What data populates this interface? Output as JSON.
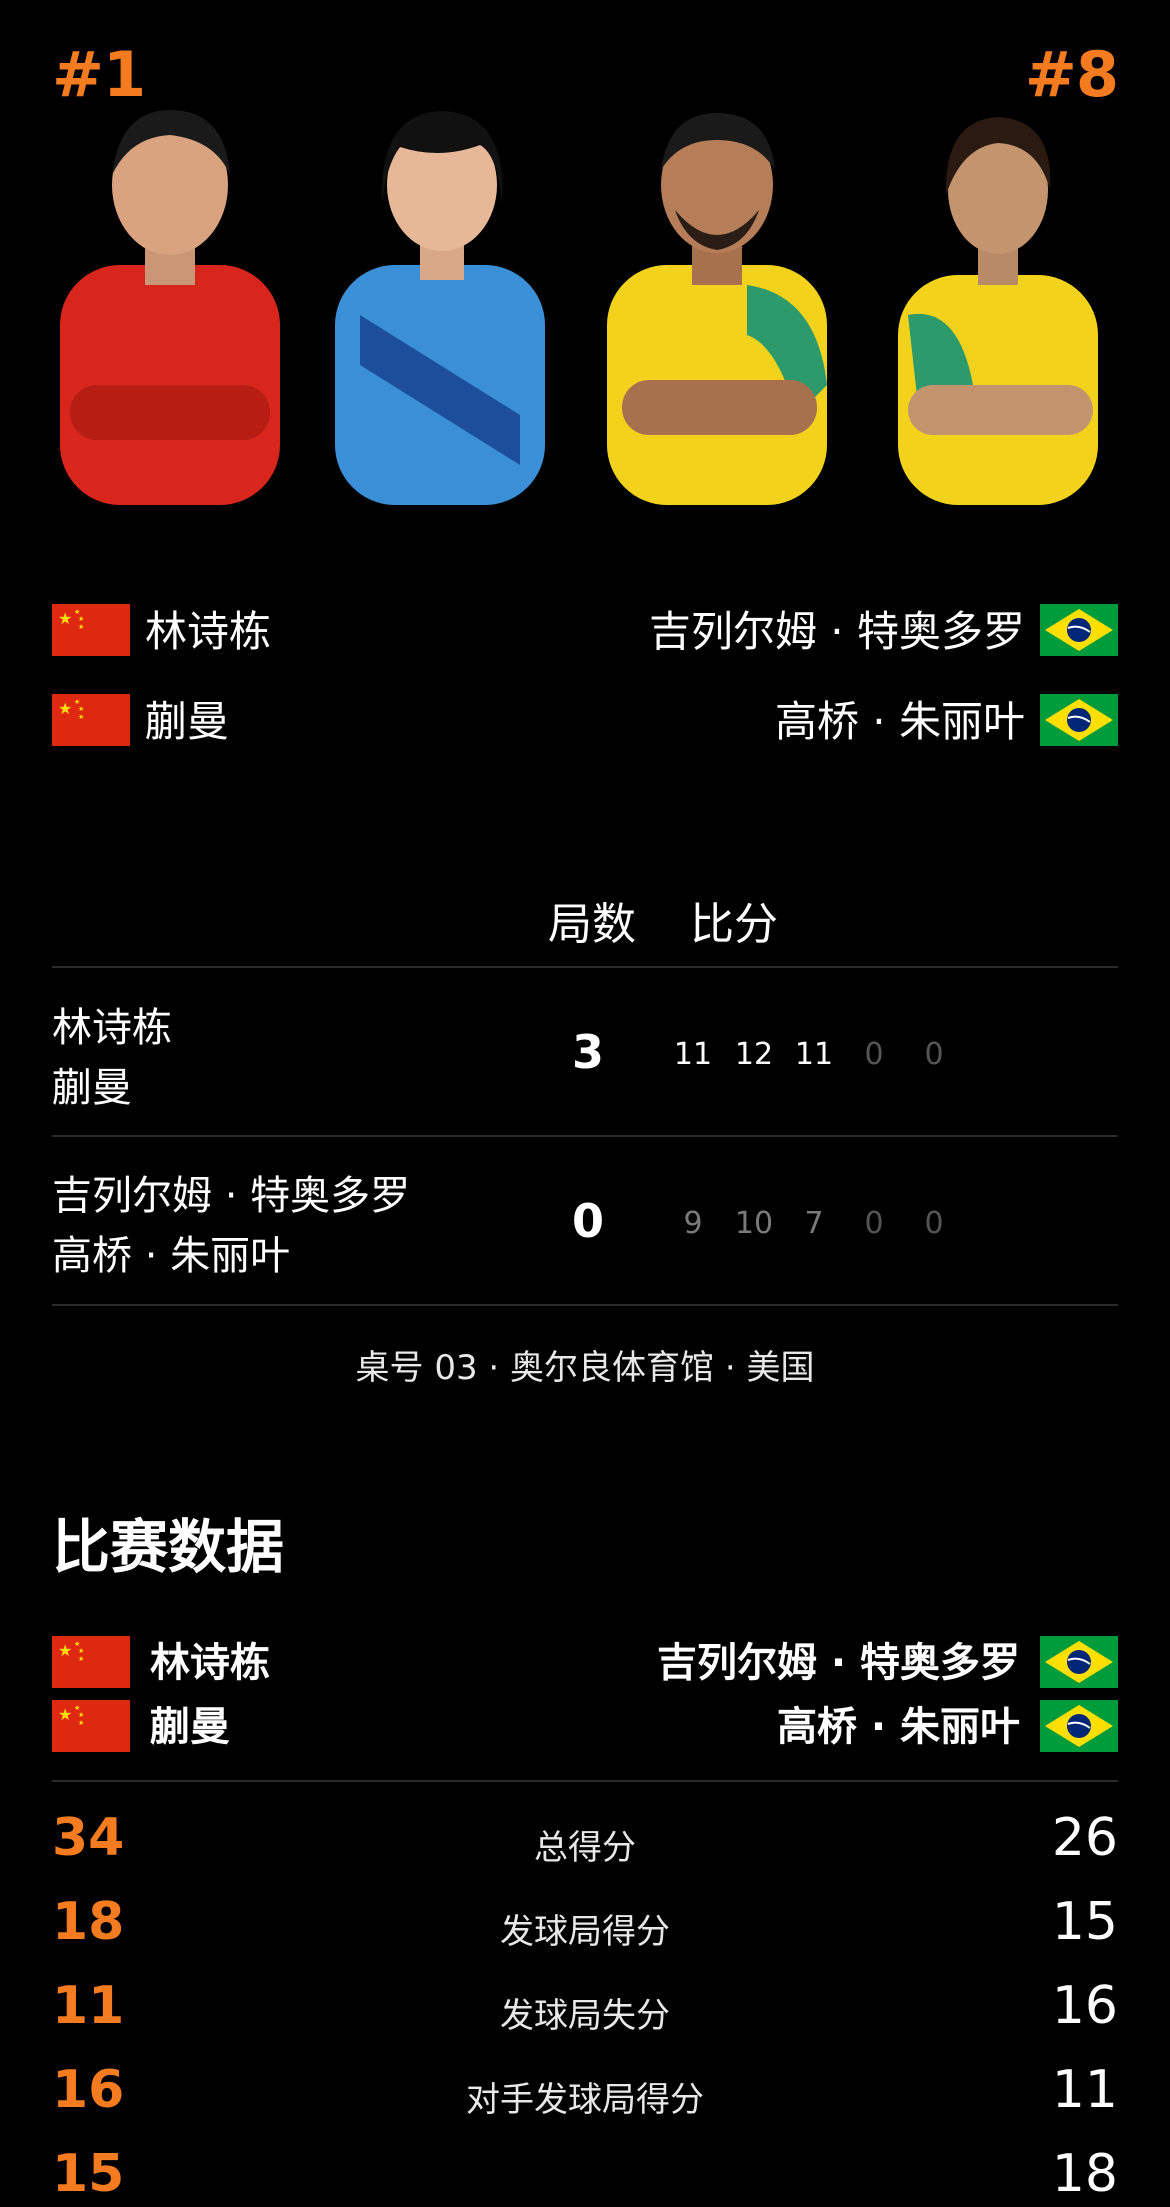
{
  "seeds": {
    "left": "#1",
    "right": "#8"
  },
  "players_left": [
    {
      "name": "林诗栋",
      "flag": "china-flag"
    },
    {
      "name": "蒯曼",
      "flag": "china-flag"
    }
  ],
  "players_right": [
    {
      "name": "吉列尔姆 · 特奥多罗",
      "flag": "brazil-flag"
    },
    {
      "name": "高桥 · 朱丽叶",
      "flag": "brazil-flag"
    }
  ],
  "score_header": {
    "games": "局数",
    "points": "比分"
  },
  "score_rows": [
    {
      "line1": "林诗栋",
      "line2": "蒯曼",
      "games": "3",
      "points": [
        "11",
        "12",
        "11",
        "0",
        "0"
      ]
    },
    {
      "line1": "吉列尔姆 · 特奥多罗",
      "line2": "高桥 · 朱丽叶",
      "games": "0",
      "points": [
        "9",
        "10",
        "7",
        "0",
        "0"
      ]
    }
  ],
  "venue": "桌号 03 · 奥尔良体育馆 · 美国",
  "stats_title": "比赛数据",
  "stats": [
    {
      "left": "34",
      "label": "总得分",
      "right": "26"
    },
    {
      "left": "18",
      "label": "发球局得分",
      "right": "15"
    },
    {
      "left": "11",
      "label": "发球局失分",
      "right": "16"
    },
    {
      "left": "16",
      "label": "对手发球局得分",
      "right": "11"
    },
    {
      "left": "15",
      "label": "",
      "right": "18"
    }
  ],
  "colors": {
    "accent": "#f47b20",
    "background": "#000000",
    "muted": "#7a7a7a"
  }
}
